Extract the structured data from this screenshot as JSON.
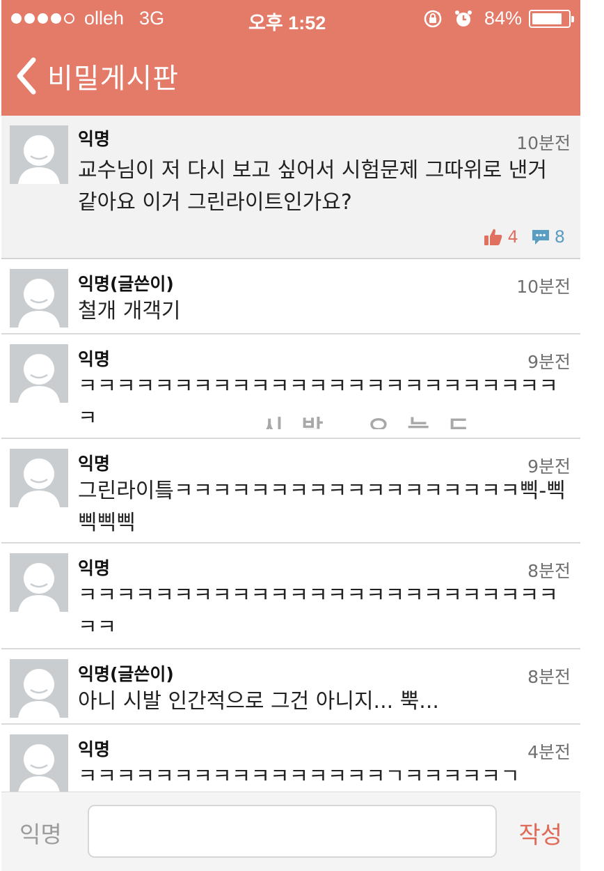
{
  "status_bar": {
    "carrier": "olleh",
    "network": "3G",
    "time": "오후 1:52",
    "battery_percent_text": "84%",
    "battery_level": 0.84,
    "signal_bars_filled": 4,
    "signal_bars_total": 5
  },
  "nav": {
    "title": "비밀게시판"
  },
  "post": {
    "author": "익명",
    "time": "10분전",
    "text": "교수님이 저 다시 보고 싶어서 시험문제 그따위로 낸거 같아요 이거 그린라이트인가요?",
    "likes": "4",
    "comments": "8"
  },
  "comments": [
    {
      "author": "익명(글쓴이)",
      "time": "10분전",
      "text": "철개 개객기"
    },
    {
      "author": "익명",
      "time": "9분전",
      "text": "ㅋㅋㅋㅋㅋㅋㅋㅋㅋㅋㅋㅋㅋㅋㅋㅋㅋㅋㅋㅋㅋㅋㅋㅋㅋㅋ"
    },
    {
      "author": "익명",
      "time": "9분전",
      "text": "그린라이틐ㅋㅋㅋㅋㅋㅋㅋㅋㅋㅋㅋㅋㅋㅋㅋㅋㅋㅋ삑-삑삑삑삑"
    },
    {
      "author": "익명",
      "time": "8분전",
      "text": "ㅋㅋㅋㅋㅋㅋㅋㅋㅋㅋㅋㅋㅋㅋㅋㅋㅋㅋㅋㅋㅋㅋㅋㅋㅋㅋㅋ"
    },
    {
      "author": "익명(글쓴이)",
      "time": "8분전",
      "text": "아니 시발 인간적으로 그건 아니지... 뿍..."
    },
    {
      "author": "익명",
      "time": "4분전",
      "text": "ㅋㅋㅋㅋㅋㅋㅋㅋㅋㅋㅋㅋㅋㅋㅋㅋㄱㅋㅋㅋㅋㅋㄱ"
    }
  ],
  "watermark": "시발 오늘도",
  "input_bar": {
    "anon_label": "익명",
    "placeholder": "",
    "submit_label": "작성"
  },
  "colors": {
    "header": "#e47a68",
    "like": "#e07060",
    "comment": "#5a9cc2",
    "submit": "#e06a57"
  }
}
